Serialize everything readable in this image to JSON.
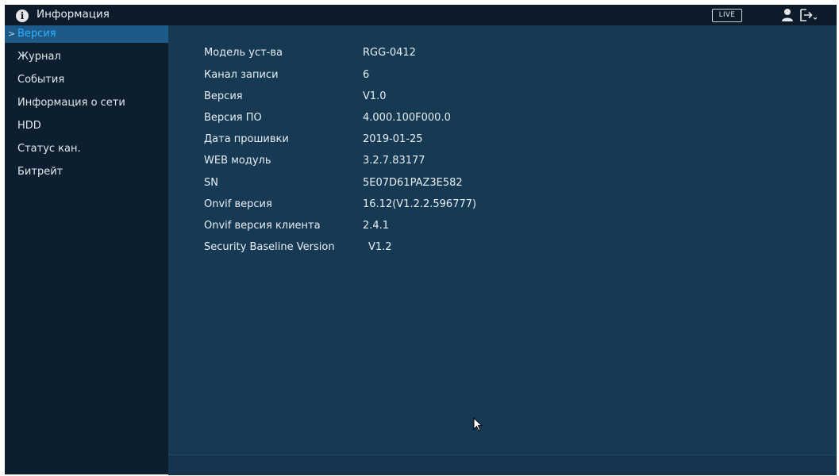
{
  "header": {
    "title": "Информация",
    "live_label": "LIVE"
  },
  "sidebar": {
    "items": [
      {
        "label": "Версия",
        "active": true
      },
      {
        "label": "Журнал"
      },
      {
        "label": "События"
      },
      {
        "label": "Информация о сети"
      },
      {
        "label": "HDD"
      },
      {
        "label": "Статус кан."
      },
      {
        "label": "Битрейт"
      }
    ]
  },
  "info": {
    "rows": [
      {
        "label": "Модель уст-ва",
        "value": "RGG-0412"
      },
      {
        "label": "Канал записи",
        "value": "6"
      },
      {
        "label": "Версия",
        "value": "V1.0"
      },
      {
        "label": "Версия ПО",
        "value": "4.000.100F000.0"
      },
      {
        "label": "Дата прошивки",
        "value": "2019-01-25"
      },
      {
        "label": "WEB модуль",
        "value": "3.2.7.83177"
      },
      {
        "label": "SN",
        "value": "5E07D61PAZ3E582"
      },
      {
        "label": "Onvif версия",
        "value": "16.12(V1.2.2.596777)"
      },
      {
        "label": "Onvif версия клиента",
        "value": "2.4.1"
      },
      {
        "label": "Security Baseline Version",
        "value": "V1.2"
      }
    ]
  },
  "colors": {
    "accent": "#2fb0ff",
    "panel_bg": "#173a54",
    "sidebar_bg": "#0d1f2e",
    "topbar_bg": "#0c1b29"
  }
}
